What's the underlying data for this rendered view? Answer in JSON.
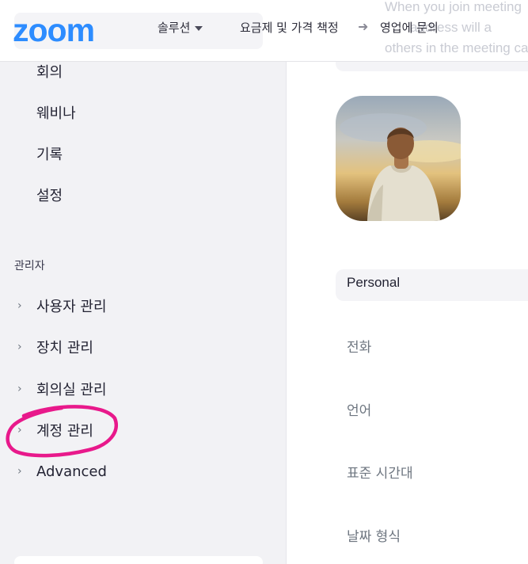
{
  "header": {
    "logo": "zoom",
    "nav": {
      "solutions": "솔루션",
      "pricing": "요금제 및 가격 책정",
      "sales": "영업에 문의"
    },
    "background_text": [
      "When you join meeting",
      "address will a",
      "others in the meeting ca"
    ]
  },
  "sidebar": {
    "items": [
      "회의",
      "웨비나",
      "기록",
      "설정"
    ],
    "admin_label": "관리자",
    "admin_items": [
      "사용자 관리",
      "장치 관리",
      "회의실 관리",
      "계정 관리",
      "Advanced"
    ],
    "highlight_color": "#e8198b"
  },
  "main": {
    "tab": "Personal",
    "settings": [
      "전화",
      "언어",
      "표준 시간대",
      "날짜 형식"
    ]
  },
  "colors": {
    "brand": "#2d8cff",
    "sidebar_bg": "#f2f2f5"
  }
}
